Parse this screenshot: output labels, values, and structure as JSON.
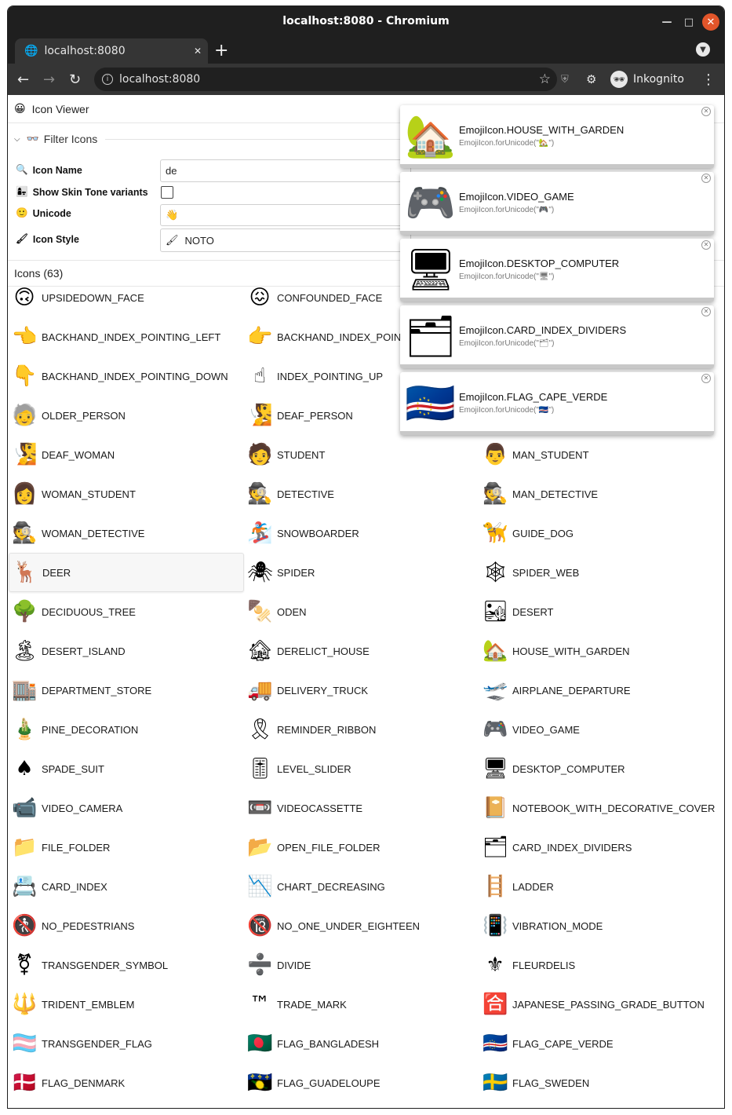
{
  "browser": {
    "window_title": "localhost:8080 - Chromium",
    "tab_title": "localhost:8080",
    "new_tab_symbol": "+",
    "tab_close_symbol": "✕",
    "address": "localhost:8080",
    "profile": "Inkognito"
  },
  "app": {
    "title": "Icon Viewer",
    "title_icon": "😀",
    "filter_header": "Filter Icons",
    "filter_icon": "👓",
    "filters": [
      {
        "label": "Icon Name",
        "icon": "🔍",
        "value": "de"
      },
      {
        "label": "Show Skin Tone variants",
        "icon": "👩‍👧"
      },
      {
        "label": "Unicode",
        "icon": "🙂",
        "value": "👋"
      },
      {
        "label": "Icon Style",
        "icon": "🖌",
        "value": "NOTO",
        "value_icon": "🖌"
      }
    ],
    "icons_header": "Icons (63)"
  },
  "icons": [
    {
      "e": "🙃",
      "n": "UPSIDEDOWN_FACE"
    },
    {
      "e": "😖",
      "n": "CONFOUNDED_FACE"
    },
    {
      "e": "",
      "n": ""
    },
    {
      "e": "👈",
      "n": "BACKHAND_INDEX_POINTING_LEFT"
    },
    {
      "e": "👉",
      "n": "BACKHAND_INDEX_POINTING_RIGHT"
    },
    {
      "e": "",
      "n": ""
    },
    {
      "e": "👇",
      "n": "BACKHAND_INDEX_POINTING_DOWN"
    },
    {
      "e": "☝",
      "n": "INDEX_POINTING_UP"
    },
    {
      "e": "",
      "n": ""
    },
    {
      "e": "🧓",
      "n": "OLDER_PERSON"
    },
    {
      "e": "🧏",
      "n": "DEAF_PERSON"
    },
    {
      "e": "",
      "n": ""
    },
    {
      "e": "🧏",
      "n": "DEAF_WOMAN"
    },
    {
      "e": "🧑",
      "n": "STUDENT"
    },
    {
      "e": "👨",
      "n": "MAN_STUDENT"
    },
    {
      "e": "👩",
      "n": "WOMAN_STUDENT"
    },
    {
      "e": "🕵",
      "n": "DETECTIVE"
    },
    {
      "e": "🕵",
      "n": "MAN_DETECTIVE"
    },
    {
      "e": "🕵",
      "n": "WOMAN_DETECTIVE"
    },
    {
      "e": "🏂",
      "n": "SNOWBOARDER"
    },
    {
      "e": "🦮",
      "n": "GUIDE_DOG"
    },
    {
      "e": "🦌",
      "n": "DEER"
    },
    {
      "e": "🕷",
      "n": "SPIDER"
    },
    {
      "e": "🕸",
      "n": "SPIDER_WEB"
    },
    {
      "e": "🌳",
      "n": "DECIDUOUS_TREE"
    },
    {
      "e": "🍢",
      "n": "ODEN"
    },
    {
      "e": "🏜",
      "n": "DESERT"
    },
    {
      "e": "🏝",
      "n": "DESERT_ISLAND"
    },
    {
      "e": "🏚",
      "n": "DERELICT_HOUSE"
    },
    {
      "e": "🏡",
      "n": "HOUSE_WITH_GARDEN"
    },
    {
      "e": "🏬",
      "n": "DEPARTMENT_STORE"
    },
    {
      "e": "🚚",
      "n": "DELIVERY_TRUCK"
    },
    {
      "e": "🛫",
      "n": "AIRPLANE_DEPARTURE"
    },
    {
      "e": "🎍",
      "n": "PINE_DECORATION"
    },
    {
      "e": "🎗",
      "n": "REMINDER_RIBBON"
    },
    {
      "e": "🎮",
      "n": "VIDEO_GAME"
    },
    {
      "e": "♠",
      "n": "SPADE_SUIT"
    },
    {
      "e": "🎚",
      "n": "LEVEL_SLIDER"
    },
    {
      "e": "🖥",
      "n": "DESKTOP_COMPUTER"
    },
    {
      "e": "📹",
      "n": "VIDEO_CAMERA"
    },
    {
      "e": "📼",
      "n": "VIDEOCASSETTE"
    },
    {
      "e": "📔",
      "n": "NOTEBOOK_WITH_DECORATIVE_COVER"
    },
    {
      "e": "📁",
      "n": "FILE_FOLDER"
    },
    {
      "e": "📂",
      "n": "OPEN_FILE_FOLDER"
    },
    {
      "e": "🗂",
      "n": "CARD_INDEX_DIVIDERS"
    },
    {
      "e": "📇",
      "n": "CARD_INDEX"
    },
    {
      "e": "📉",
      "n": "CHART_DECREASING"
    },
    {
      "e": "🪜",
      "n": "LADDER"
    },
    {
      "e": "🚷",
      "n": "NO_PEDESTRIANS"
    },
    {
      "e": "🔞",
      "n": "NO_ONE_UNDER_EIGHTEEN"
    },
    {
      "e": "📳",
      "n": "VIBRATION_MODE"
    },
    {
      "e": "⚧",
      "n": "TRANSGENDER_SYMBOL"
    },
    {
      "e": "➗",
      "n": "DIVIDE"
    },
    {
      "e": "⚜",
      "n": "FLEURDELIS"
    },
    {
      "e": "🔱",
      "n": "TRIDENT_EMBLEM"
    },
    {
      "e": "™",
      "n": "TRADE_MARK"
    },
    {
      "e": "🈴",
      "n": "JAPANESE_PASSING_GRADE_BUTTON"
    },
    {
      "e": "🏳️‍⚧️",
      "n": "TRANSGENDER_FLAG"
    },
    {
      "e": "🇧🇩",
      "n": "FLAG_BANGLADESH"
    },
    {
      "e": "🇨🇻",
      "n": "FLAG_CAPE_VERDE"
    },
    {
      "e": "🇩🇰",
      "n": "FLAG_DENMARK"
    },
    {
      "e": "🇬🇵",
      "n": "FLAG_GUADELOUPE"
    },
    {
      "e": "🇸🇪",
      "n": "FLAG_SWEDEN"
    }
  ],
  "notifications": [
    {
      "icon": "🏡",
      "title": "EmojiIcon.HOUSE_WITH_GARDEN",
      "sub": "EmojiIcon.forUnicode(\"🏡\")"
    },
    {
      "icon": "🎮",
      "title": "EmojiIcon.VIDEO_GAME",
      "sub": "EmojiIcon.forUnicode(\"🎮\")"
    },
    {
      "icon": "🖥",
      "title": "EmojiIcon.DESKTOP_COMPUTER",
      "sub": "EmojiIcon.forUnicode(\"🖥\")"
    },
    {
      "icon": "🗂",
      "title": "EmojiIcon.CARD_INDEX_DIVIDERS",
      "sub": "EmojiIcon.forUnicode(\"🗂\")"
    },
    {
      "icon": "🇨🇻",
      "title": "EmojiIcon.FLAG_CAPE_VERDE",
      "sub": "EmojiIcon.forUnicode(\"🇨🇻\")"
    }
  ]
}
